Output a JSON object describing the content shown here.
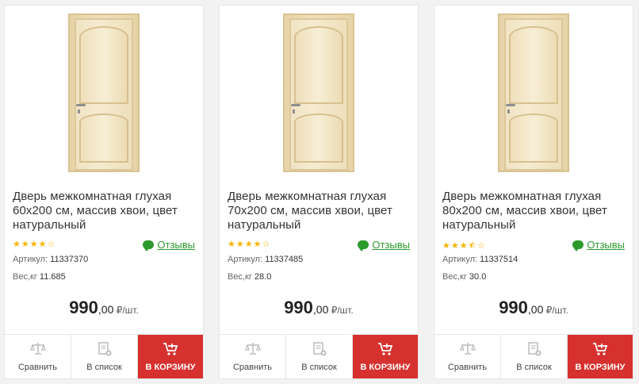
{
  "products": [
    {
      "title": "Дверь межкомнатная глухая 60x200 см, массив хвои, цвет натуральный",
      "title_lines": [
        "Дверь межкомнатная глухая",
        "60x200 см, массив хвои, цвет",
        "натуральный"
      ],
      "rating_stars": "★★★★☆",
      "rating_value": 4,
      "reviews_label": "Отзывы",
      "article_label": "Артикул:",
      "article": "11337370",
      "weight_label": "Вес,кг",
      "weight": "11.685",
      "price_main": "990",
      "price_cents": ",00",
      "price_unit": " ₽/шт.",
      "compare_label": "Сравнить",
      "list_label": "В список",
      "cart_label": "В КОРЗИНУ"
    },
    {
      "title": "Дверь межкомнатная глухая 70x200 см, массив хвои, цвет натуральный",
      "title_lines": [
        "Дверь межкомнатная глухая",
        "70x200 см, массив хвои, цвет",
        "натуральный"
      ],
      "rating_stars": "★★★★☆",
      "rating_value": 4,
      "reviews_label": "Отзывы",
      "article_label": "Артикул:",
      "article": "11337485",
      "weight_label": "Вес,кг",
      "weight": "28.0",
      "price_main": "990",
      "price_cents": ",00",
      "price_unit": " ₽/шт.",
      "compare_label": "Сравнить",
      "list_label": "В список",
      "cart_label": "В КОРЗИНУ"
    },
    {
      "title": "Дверь межкомнатная глухая 80x200 см, массив хвои, цвет натуральный",
      "title_lines": [
        "Дверь межкомнатная глухая",
        "80x200 см, массив хвои, цвет",
        "натуральный"
      ],
      "rating_stars": "★★★⯪☆",
      "rating_value": 3.5,
      "reviews_label": "Отзывы",
      "article_label": "Артикул:",
      "article": "11337514",
      "weight_label": "Вес,кг",
      "weight": "30.0",
      "price_main": "990",
      "price_cents": ",00",
      "price_unit": " ₽/шт.",
      "compare_label": "Сравнить",
      "list_label": "В список",
      "cart_label": "В КОРЗИНУ"
    }
  ],
  "colors": {
    "accent_red": "#d6312f",
    "reviews_green": "#2e9a2e",
    "star_yellow": "#f5b301"
  },
  "icons": {
    "compare": "scale-icon",
    "list": "add-to-list-icon",
    "cart": "cart-icon",
    "reviews": "chat-bubble-icon"
  }
}
